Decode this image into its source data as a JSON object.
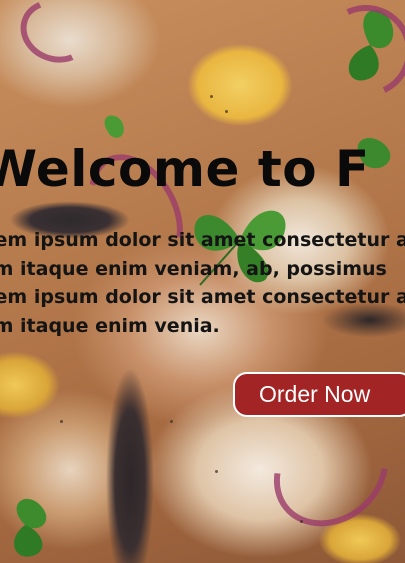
{
  "hero": {
    "title": "Welcome to F",
    "paragraph_lines": [
      "Lorem ipsum dolor sit amet consectetur adip",
      "Illum itaque enim veniam, ab, possimus",
      "Lorem ipsum dolor sit amet consectetur adip",
      "Illum itaque enim venia."
    ],
    "order_button_label": "Order Now",
    "background_image": "pizza-topping-photo"
  },
  "colors": {
    "button_bg": "#a32424",
    "button_text": "#ffffff",
    "heading_text": "#0a0a0a"
  }
}
